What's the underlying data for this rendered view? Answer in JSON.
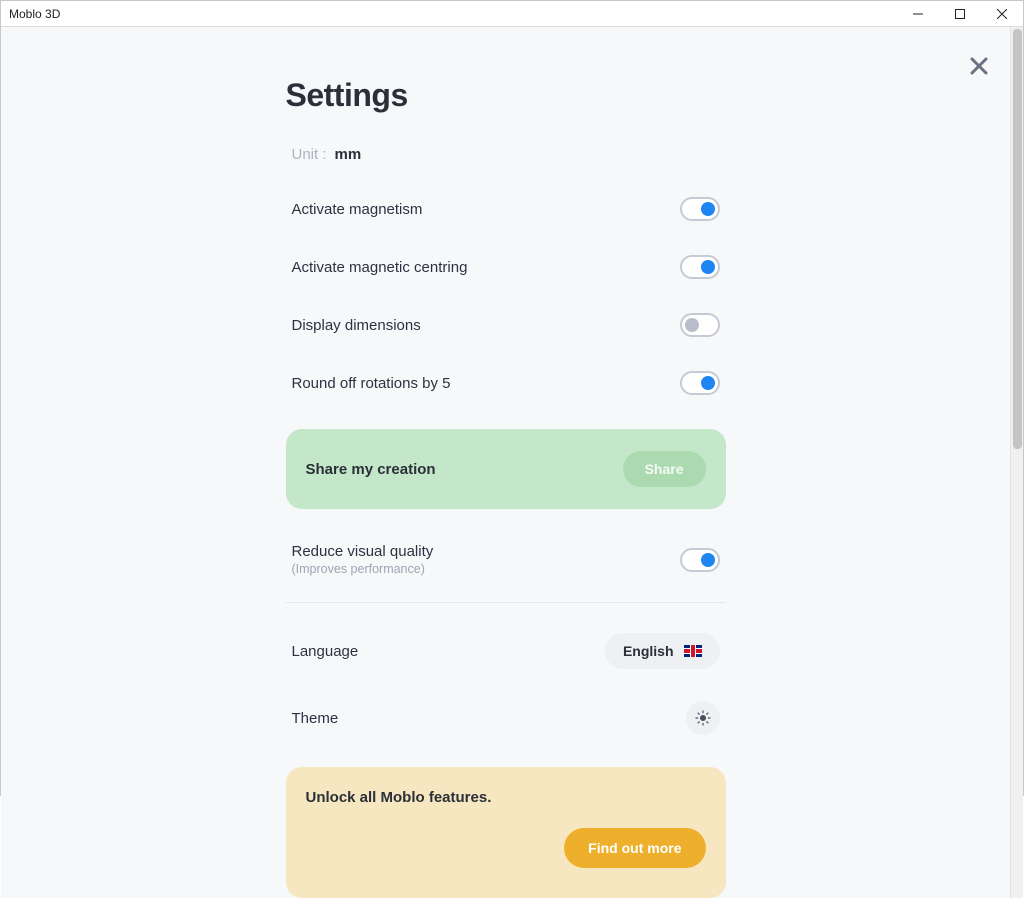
{
  "window": {
    "title": "Moblo 3D"
  },
  "settings": {
    "title": "Settings",
    "unit": {
      "label": "Unit :",
      "value": "mm"
    },
    "toggles": {
      "magnetism": {
        "label": "Activate magnetism",
        "on": true
      },
      "centring": {
        "label": "Activate magnetic centring",
        "on": true
      },
      "dimensions": {
        "label": "Display dimensions",
        "on": false
      },
      "round_rotations": {
        "label": "Round off rotations by 5",
        "on": true
      },
      "reduce_quality": {
        "label": "Reduce visual quality",
        "sublabel": "(Improves performance)",
        "on": true
      }
    },
    "share": {
      "title": "Share my creation",
      "button": "Share"
    },
    "language": {
      "label": "Language",
      "value": "English"
    },
    "theme": {
      "label": "Theme"
    },
    "unlock": {
      "title": "Unlock all Moblo features.",
      "button": "Find out more"
    }
  }
}
